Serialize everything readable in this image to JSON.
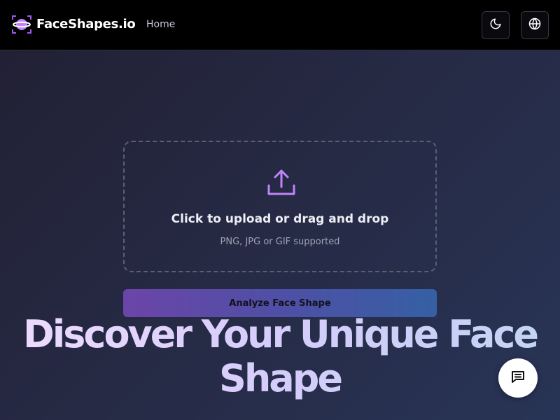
{
  "header": {
    "brand": "FaceShapes.io",
    "nav": {
      "home": "Home"
    },
    "logo_icon": "face-scan-logo-icon",
    "theme_icon": "moon-icon",
    "language_icon": "globe-icon"
  },
  "upload": {
    "icon": "upload-icon",
    "title": "Click to upload or drag and drop",
    "subtitle": "PNG, JPG or GIF supported"
  },
  "actions": {
    "analyze_label": "Analyze Face Shape"
  },
  "hero": {
    "headline_line1": "Discover Your Unique Face",
    "headline_line2": "Shape"
  },
  "chat": {
    "icon": "chat-icon"
  },
  "colors": {
    "accent": "#a855f7",
    "header_bg": "#000000",
    "button_gradient_start": "#6b45a8",
    "button_gradient_end": "#3560a3"
  }
}
